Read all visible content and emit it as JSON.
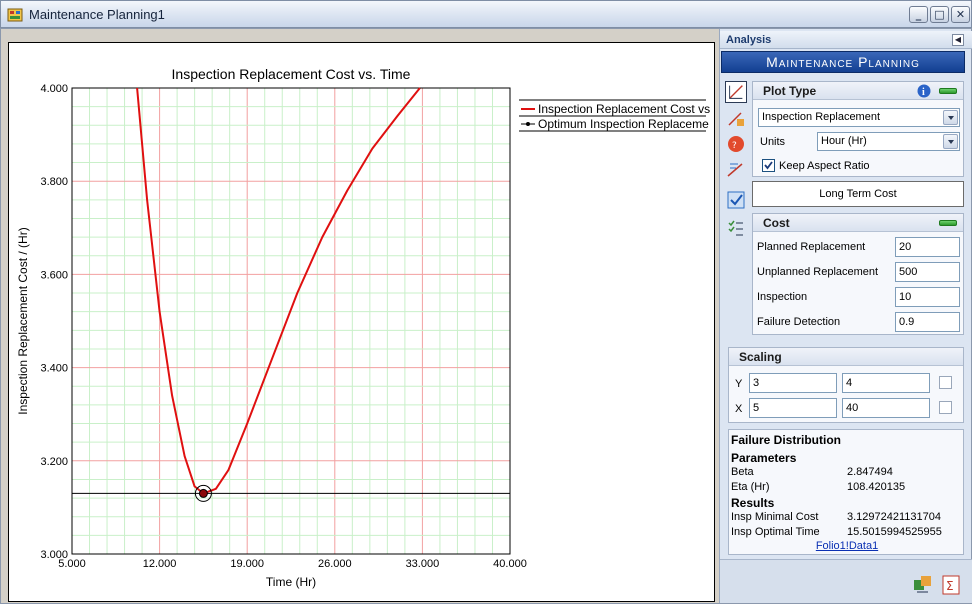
{
  "window": {
    "title": "Maintenance Planning1",
    "buttons": {
      "minimize": "_",
      "maximize": "□",
      "close": "✕"
    }
  },
  "chart_data": {
    "type": "line",
    "title": "Inspection Replacement Cost vs. Time",
    "xlabel": "Time (Hr)",
    "ylabel": "Inspection Replacement Cost / (Hr)",
    "xlim": [
      5,
      40
    ],
    "ylim": [
      3,
      4
    ],
    "xticks": [
      "5.000",
      "12.000",
      "19.000",
      "26.000",
      "33.000",
      "40.000"
    ],
    "yticks": [
      "3.000",
      "3.200",
      "3.400",
      "3.600",
      "3.800",
      "4.000"
    ],
    "grid": true,
    "legend_position": "right",
    "series": [
      {
        "name": "Inspection Replacement Cost vs",
        "color": "#e01010",
        "points": [
          [
            10.2,
            4.0
          ],
          [
            11.0,
            3.76
          ],
          [
            12.0,
            3.52
          ],
          [
            13.0,
            3.34
          ],
          [
            14.0,
            3.21
          ],
          [
            14.8,
            3.145
          ],
          [
            15.5,
            3.13
          ],
          [
            16.5,
            3.14
          ],
          [
            17.5,
            3.18
          ],
          [
            19.0,
            3.28
          ],
          [
            21.0,
            3.42
          ],
          [
            23.0,
            3.56
          ],
          [
            25.0,
            3.68
          ],
          [
            27.0,
            3.78
          ],
          [
            29.0,
            3.87
          ],
          [
            31.0,
            3.94
          ],
          [
            32.8,
            4.0
          ]
        ]
      },
      {
        "name": "Optimum Inspection Replaceme",
        "color": "#000000",
        "y": 3.13,
        "point": [
          15.5,
          3.13
        ]
      }
    ]
  },
  "panel": {
    "header": "Analysis",
    "banner": "Maintenance Planning",
    "plot_type": {
      "title": "Plot Type",
      "plot_select": "Inspection Replacement",
      "units_label": "Units",
      "units_select": "Hour (Hr)",
      "keep_aspect_label": "Keep Aspect Ratio",
      "keep_aspect_checked": true
    },
    "long_term_cost": "Long Term Cost",
    "cost": {
      "title": "Cost",
      "rows": [
        {
          "label": "Planned Replacement",
          "value": "20"
        },
        {
          "label": "Unplanned Replacement",
          "value": "500"
        },
        {
          "label": "Inspection",
          "value": "10"
        },
        {
          "label": "Failure Detection",
          "value": "0.9"
        }
      ]
    },
    "scaling": {
      "title": "Scaling",
      "y_label": "Y",
      "y_min": "3",
      "y_max": "4",
      "x_label": "X",
      "x_min": "5",
      "x_max": "40"
    },
    "results": {
      "failure_distribution": "Failure Distribution",
      "parameters": "Parameters",
      "beta_label": "Beta",
      "beta_value": "2.847494",
      "eta_label": "Eta (Hr)",
      "eta_value": "108.420135",
      "results_title": "Results",
      "min_cost_label": "Insp Minimal Cost",
      "min_cost_value": "3.12972421131704",
      "opt_time_label": "Insp Optimal Time",
      "opt_time_value": "15.5015994525955",
      "folio_link": "Folio1!Data1"
    }
  }
}
